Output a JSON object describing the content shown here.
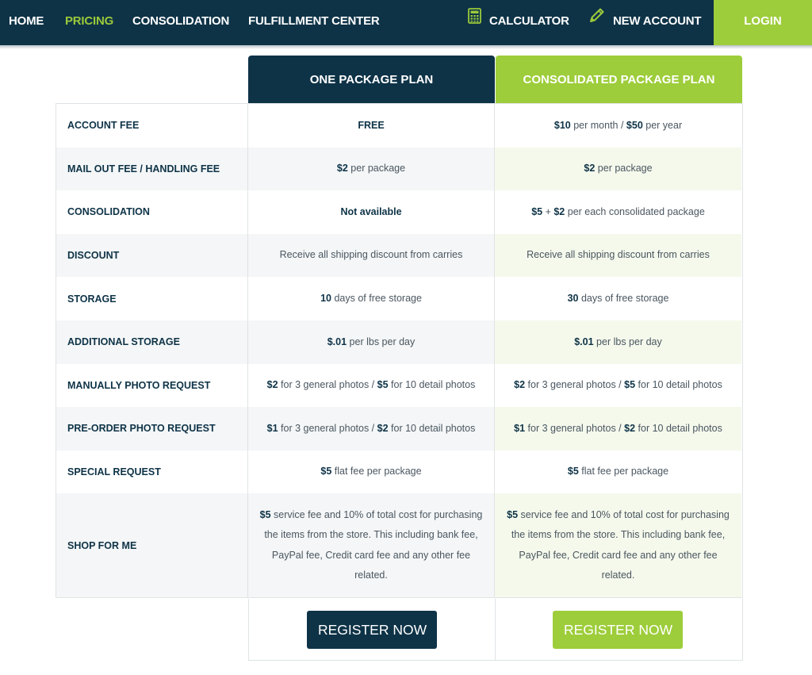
{
  "nav": {
    "home": "HOME",
    "pricing": "PRICING",
    "consolidation": "CONSOLIDATION",
    "fulfillment": "FULFILLMENT CENTER",
    "calculator": "CALCULATOR",
    "new_account": "NEW ACCOUNT",
    "login": "LOGIN",
    "icons": {
      "calculator": "calculator-icon",
      "new_account": "pencil-icon"
    },
    "colors": {
      "nav_bg": "#0e3347",
      "active": "#9bc93b",
      "login_bg": "#9dcd3a"
    }
  },
  "plans": {
    "one": {
      "title": "ONE PACKAGE PLAN",
      "register": "REGISTER NOW"
    },
    "cons": {
      "title": "CONSOLIDATED PACKAGE PLAN",
      "register": "REGISTER NOW"
    }
  },
  "rows": [
    {
      "label": "ACCOUNT FEE",
      "one": [
        [
          "b",
          "FREE"
        ]
      ],
      "cons": [
        [
          "b",
          "$10"
        ],
        [
          "t",
          " per month / "
        ],
        [
          "b",
          "$50"
        ],
        [
          "t",
          " per year"
        ]
      ]
    },
    {
      "label": "MAIL OUT FEE / HANDLING FEE",
      "one": [
        [
          "b",
          "$2"
        ],
        [
          "t",
          " per package"
        ]
      ],
      "cons": [
        [
          "b",
          "$2"
        ],
        [
          "t",
          " per package"
        ]
      ]
    },
    {
      "label": "CONSOLIDATION",
      "one": [
        [
          "b",
          "Not available"
        ]
      ],
      "cons": [
        [
          "b",
          "$5"
        ],
        [
          "t",
          " + "
        ],
        [
          "b",
          "$2"
        ],
        [
          "t",
          " per each consolidated package"
        ]
      ]
    },
    {
      "label": "DISCOUNT",
      "one": [
        [
          "t",
          "Receive all shipping discount from carries"
        ]
      ],
      "cons": [
        [
          "t",
          "Receive all shipping discount from carries"
        ]
      ]
    },
    {
      "label": "STORAGE",
      "one": [
        [
          "b",
          "10"
        ],
        [
          "t",
          " days of free storage"
        ]
      ],
      "cons": [
        [
          "b",
          "30"
        ],
        [
          "t",
          " days of free storage"
        ]
      ]
    },
    {
      "label": "ADDITIONAL STORAGE",
      "one": [
        [
          "b",
          "$.01"
        ],
        [
          "t",
          " per lbs per day"
        ]
      ],
      "cons": [
        [
          "b",
          "$.01"
        ],
        [
          "t",
          " per lbs per day"
        ]
      ]
    },
    {
      "label": "MANUALLY PHOTO REQUEST",
      "one": [
        [
          "b",
          "$2"
        ],
        [
          "t",
          " for 3 general photos / "
        ],
        [
          "b",
          "$5"
        ],
        [
          "t",
          " for 10 detail photos"
        ]
      ],
      "cons": [
        [
          "b",
          "$2"
        ],
        [
          "t",
          " for 3 general photos / "
        ],
        [
          "b",
          "$5"
        ],
        [
          "t",
          " for 10 detail photos"
        ]
      ]
    },
    {
      "label": "PRE-ORDER PHOTO REQUEST",
      "one": [
        [
          "b",
          "$1"
        ],
        [
          "t",
          " for 3 general photos / "
        ],
        [
          "b",
          "$2"
        ],
        [
          "t",
          " for 10 detail photos"
        ]
      ],
      "cons": [
        [
          "b",
          "$1"
        ],
        [
          "t",
          " for 3 general photos / "
        ],
        [
          "b",
          "$2"
        ],
        [
          "t",
          " for 10 detail photos"
        ]
      ]
    },
    {
      "label": "SPECIAL REQUEST",
      "one": [
        [
          "b",
          "$5"
        ],
        [
          "t",
          " flat fee per package"
        ]
      ],
      "cons": [
        [
          "b",
          "$5"
        ],
        [
          "t",
          " flat fee per package"
        ]
      ]
    },
    {
      "label": "SHOP FOR ME",
      "one": [
        [
          "b",
          "$5"
        ],
        [
          "t",
          " service fee and 10% of total cost for purchasing the items from the store. This including bank fee, PayPal fee, Credit card fee and any other fee related."
        ]
      ],
      "cons": [
        [
          "b",
          "$5"
        ],
        [
          "t",
          " service fee and 10% of total cost for purchasing the items from the store. This including bank fee, PayPal fee, Credit card fee and any other fee related."
        ]
      ]
    }
  ]
}
